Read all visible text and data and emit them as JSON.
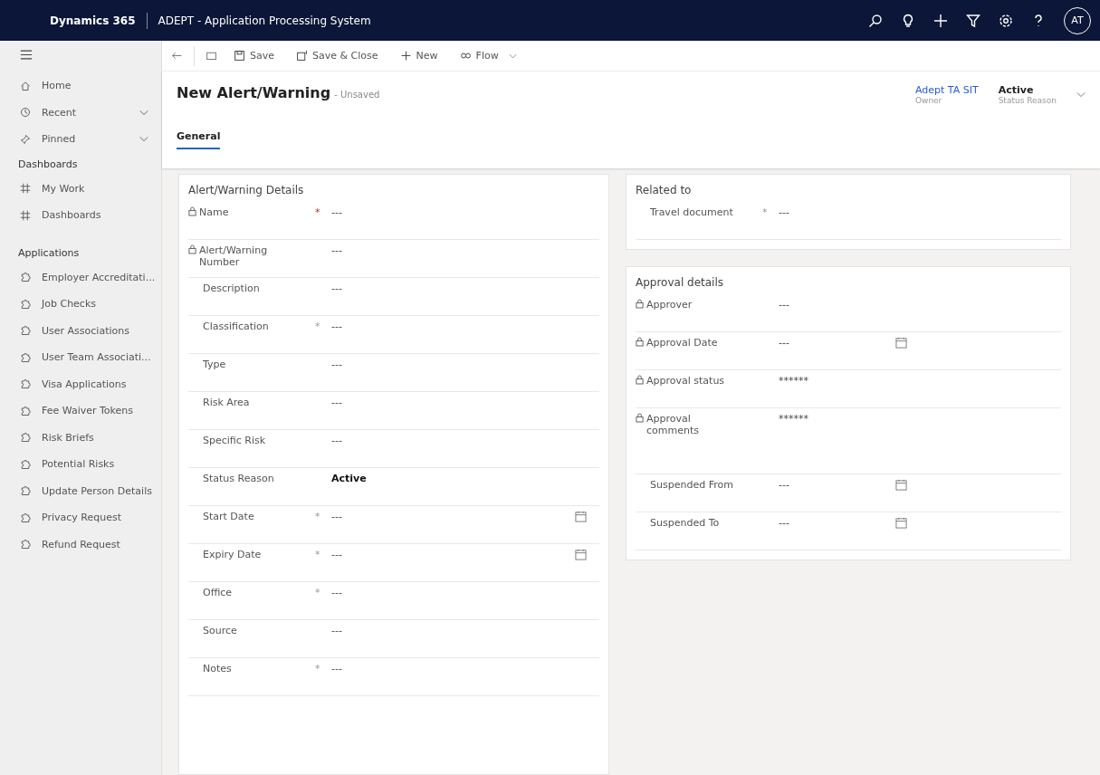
{
  "topbar": {
    "product": "Dynamics 365",
    "app_title": "ADEPT - Application Processing System",
    "avatar": "AT"
  },
  "sidebar": {
    "top_items": [
      {
        "label": "Home",
        "expandable": false
      },
      {
        "label": "Recent",
        "expandable": true
      },
      {
        "label": "Pinned",
        "expandable": true
      }
    ],
    "groups": [
      {
        "title": "Dashboards",
        "kind": "dashboard",
        "items": [
          "My Work",
          "Dashboards"
        ]
      },
      {
        "title": "Applications",
        "kind": "application",
        "items": [
          "Employer Accreditati...",
          "Job Checks",
          "User Associations",
          "User Team Associati...",
          "Visa Applications",
          "Fee Waiver Tokens",
          "Risk Briefs",
          "Potential Risks",
          "Update Person Details",
          "Privacy Request",
          "Refund Request"
        ]
      }
    ]
  },
  "commands": [
    {
      "label": "Save",
      "kind": "save"
    },
    {
      "label": "Save & Close",
      "kind": "save-close"
    },
    {
      "label": "New",
      "kind": "new"
    },
    {
      "label": "Flow",
      "kind": "flow"
    }
  ],
  "header": {
    "title": "New Alert/Warning",
    "subtitle": "- Unsaved",
    "owner": {
      "value": "Adept TA SIT",
      "label": "Owner"
    },
    "status": {
      "value": "Active",
      "label": "Status Reason"
    }
  },
  "tabs": [
    {
      "label": "General",
      "selected": true
    }
  ],
  "columns": [
    {
      "sections": [
        {
          "title": "Alert/Warning Details",
          "fields": [
            {
              "label": "Name",
              "locked": true,
              "marker": "*",
              "required": true,
              "value": "---",
              "kind": "text"
            },
            {
              "label": "Alert/Warning Number",
              "locked": true,
              "value": "---",
              "kind": "text"
            },
            {
              "label": "Description",
              "locked": false,
              "value": "---",
              "kind": "multiline"
            },
            {
              "label": "Classification",
              "locked": false,
              "marker": "*",
              "required": false,
              "value": "---",
              "kind": "text"
            },
            {
              "label": "Type",
              "locked": false,
              "value": "---",
              "kind": "text"
            },
            {
              "label": "Risk Area",
              "locked": false,
              "value": "---",
              "kind": "text"
            },
            {
              "label": "Specific Risk",
              "locked": false,
              "value": "---",
              "kind": "text"
            },
            {
              "label": "Status Reason",
              "locked": false,
              "value": "Active",
              "kind": "bold"
            },
            {
              "label": "Start Date",
              "locked": false,
              "marker": "*",
              "required": false,
              "value": "---",
              "kind": "date"
            },
            {
              "label": "Expiry Date",
              "locked": false,
              "marker": "*",
              "required": false,
              "value": "---",
              "kind": "date"
            },
            {
              "label": "Office",
              "locked": false,
              "marker": "*",
              "required": false,
              "value": "---",
              "kind": "text"
            },
            {
              "label": "Source",
              "locked": false,
              "value": "---",
              "kind": "text"
            },
            {
              "label": "Notes",
              "locked": false,
              "marker": "*",
              "required": false,
              "value": "---",
              "kind": "text"
            }
          ]
        }
      ]
    },
    {
      "sections": [
        {
          "title": "Related to",
          "fields": [
            {
              "label": "Travel document",
              "locked": false,
              "marker": "*",
              "required": false,
              "value": "---",
              "kind": "text"
            }
          ]
        },
        {
          "title": "Approval details",
          "fields": [
            {
              "label": "Approver",
              "locked": true,
              "value": "---",
              "kind": "text"
            },
            {
              "label": "Approval Date",
              "locked": true,
              "value": "---",
              "kind": "date"
            },
            {
              "label": "Approval status",
              "locked": true,
              "value": "******",
              "kind": "text"
            },
            {
              "label": "Approval comments",
              "locked": true,
              "value": "******",
              "kind": "spaced"
            },
            {
              "label": "Suspended From",
              "locked": false,
              "value": "---",
              "kind": "date"
            },
            {
              "label": "Suspended To",
              "locked": false,
              "value": "---",
              "kind": "date"
            }
          ]
        }
      ]
    }
  ]
}
